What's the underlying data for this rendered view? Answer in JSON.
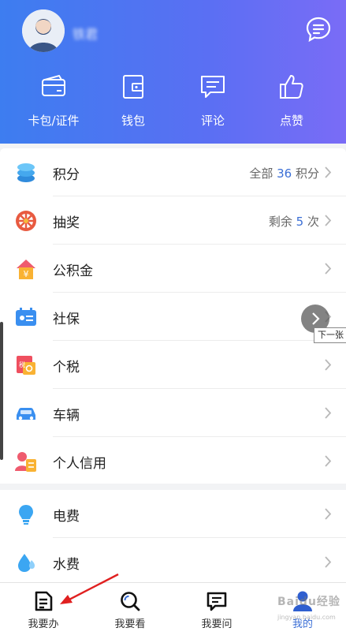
{
  "header": {
    "username": "铁君"
  },
  "quick_actions": [
    {
      "label": "卡包/证件",
      "icon": "card-wallet-icon"
    },
    {
      "label": "钱包",
      "icon": "wallet-icon"
    },
    {
      "label": "评论",
      "icon": "comment-icon"
    },
    {
      "label": "点赞",
      "icon": "thumbs-up-icon"
    }
  ],
  "menu": [
    {
      "label": "积分",
      "icon": "points-icon",
      "value_prefix": "全部",
      "value_num": "36",
      "value_suffix": "积分"
    },
    {
      "label": "抽奖",
      "icon": "lottery-icon",
      "value_prefix": "剩余",
      "value_num": "5",
      "value_suffix": "次"
    },
    {
      "label": "公积金",
      "icon": "housing-fund-icon"
    },
    {
      "label": "社保",
      "icon": "social-security-icon"
    },
    {
      "label": "个税",
      "icon": "income-tax-icon"
    },
    {
      "label": "车辆",
      "icon": "vehicle-icon"
    },
    {
      "label": "个人信用",
      "icon": "credit-icon"
    }
  ],
  "utilities": [
    {
      "label": "电费",
      "icon": "electricity-icon"
    },
    {
      "label": "水费",
      "icon": "water-icon"
    }
  ],
  "overlay": {
    "next_tooltip": "下一张"
  },
  "bottom_nav": [
    {
      "label": "我要办",
      "icon": "document-icon",
      "active": false
    },
    {
      "label": "我要看",
      "icon": "search-icon",
      "active": false
    },
    {
      "label": "我要问",
      "icon": "chat-icon",
      "active": false
    },
    {
      "label": "我的",
      "icon": "user-icon",
      "active": true
    }
  ],
  "watermark": {
    "text": "Baidu经验",
    "sub": "jingyan.baidu.com"
  },
  "colors": {
    "header_start": "#3d7df0",
    "header_end": "#7a6cf6",
    "accent": "#3b6fd6",
    "annotation_arrow": "#e02020"
  }
}
